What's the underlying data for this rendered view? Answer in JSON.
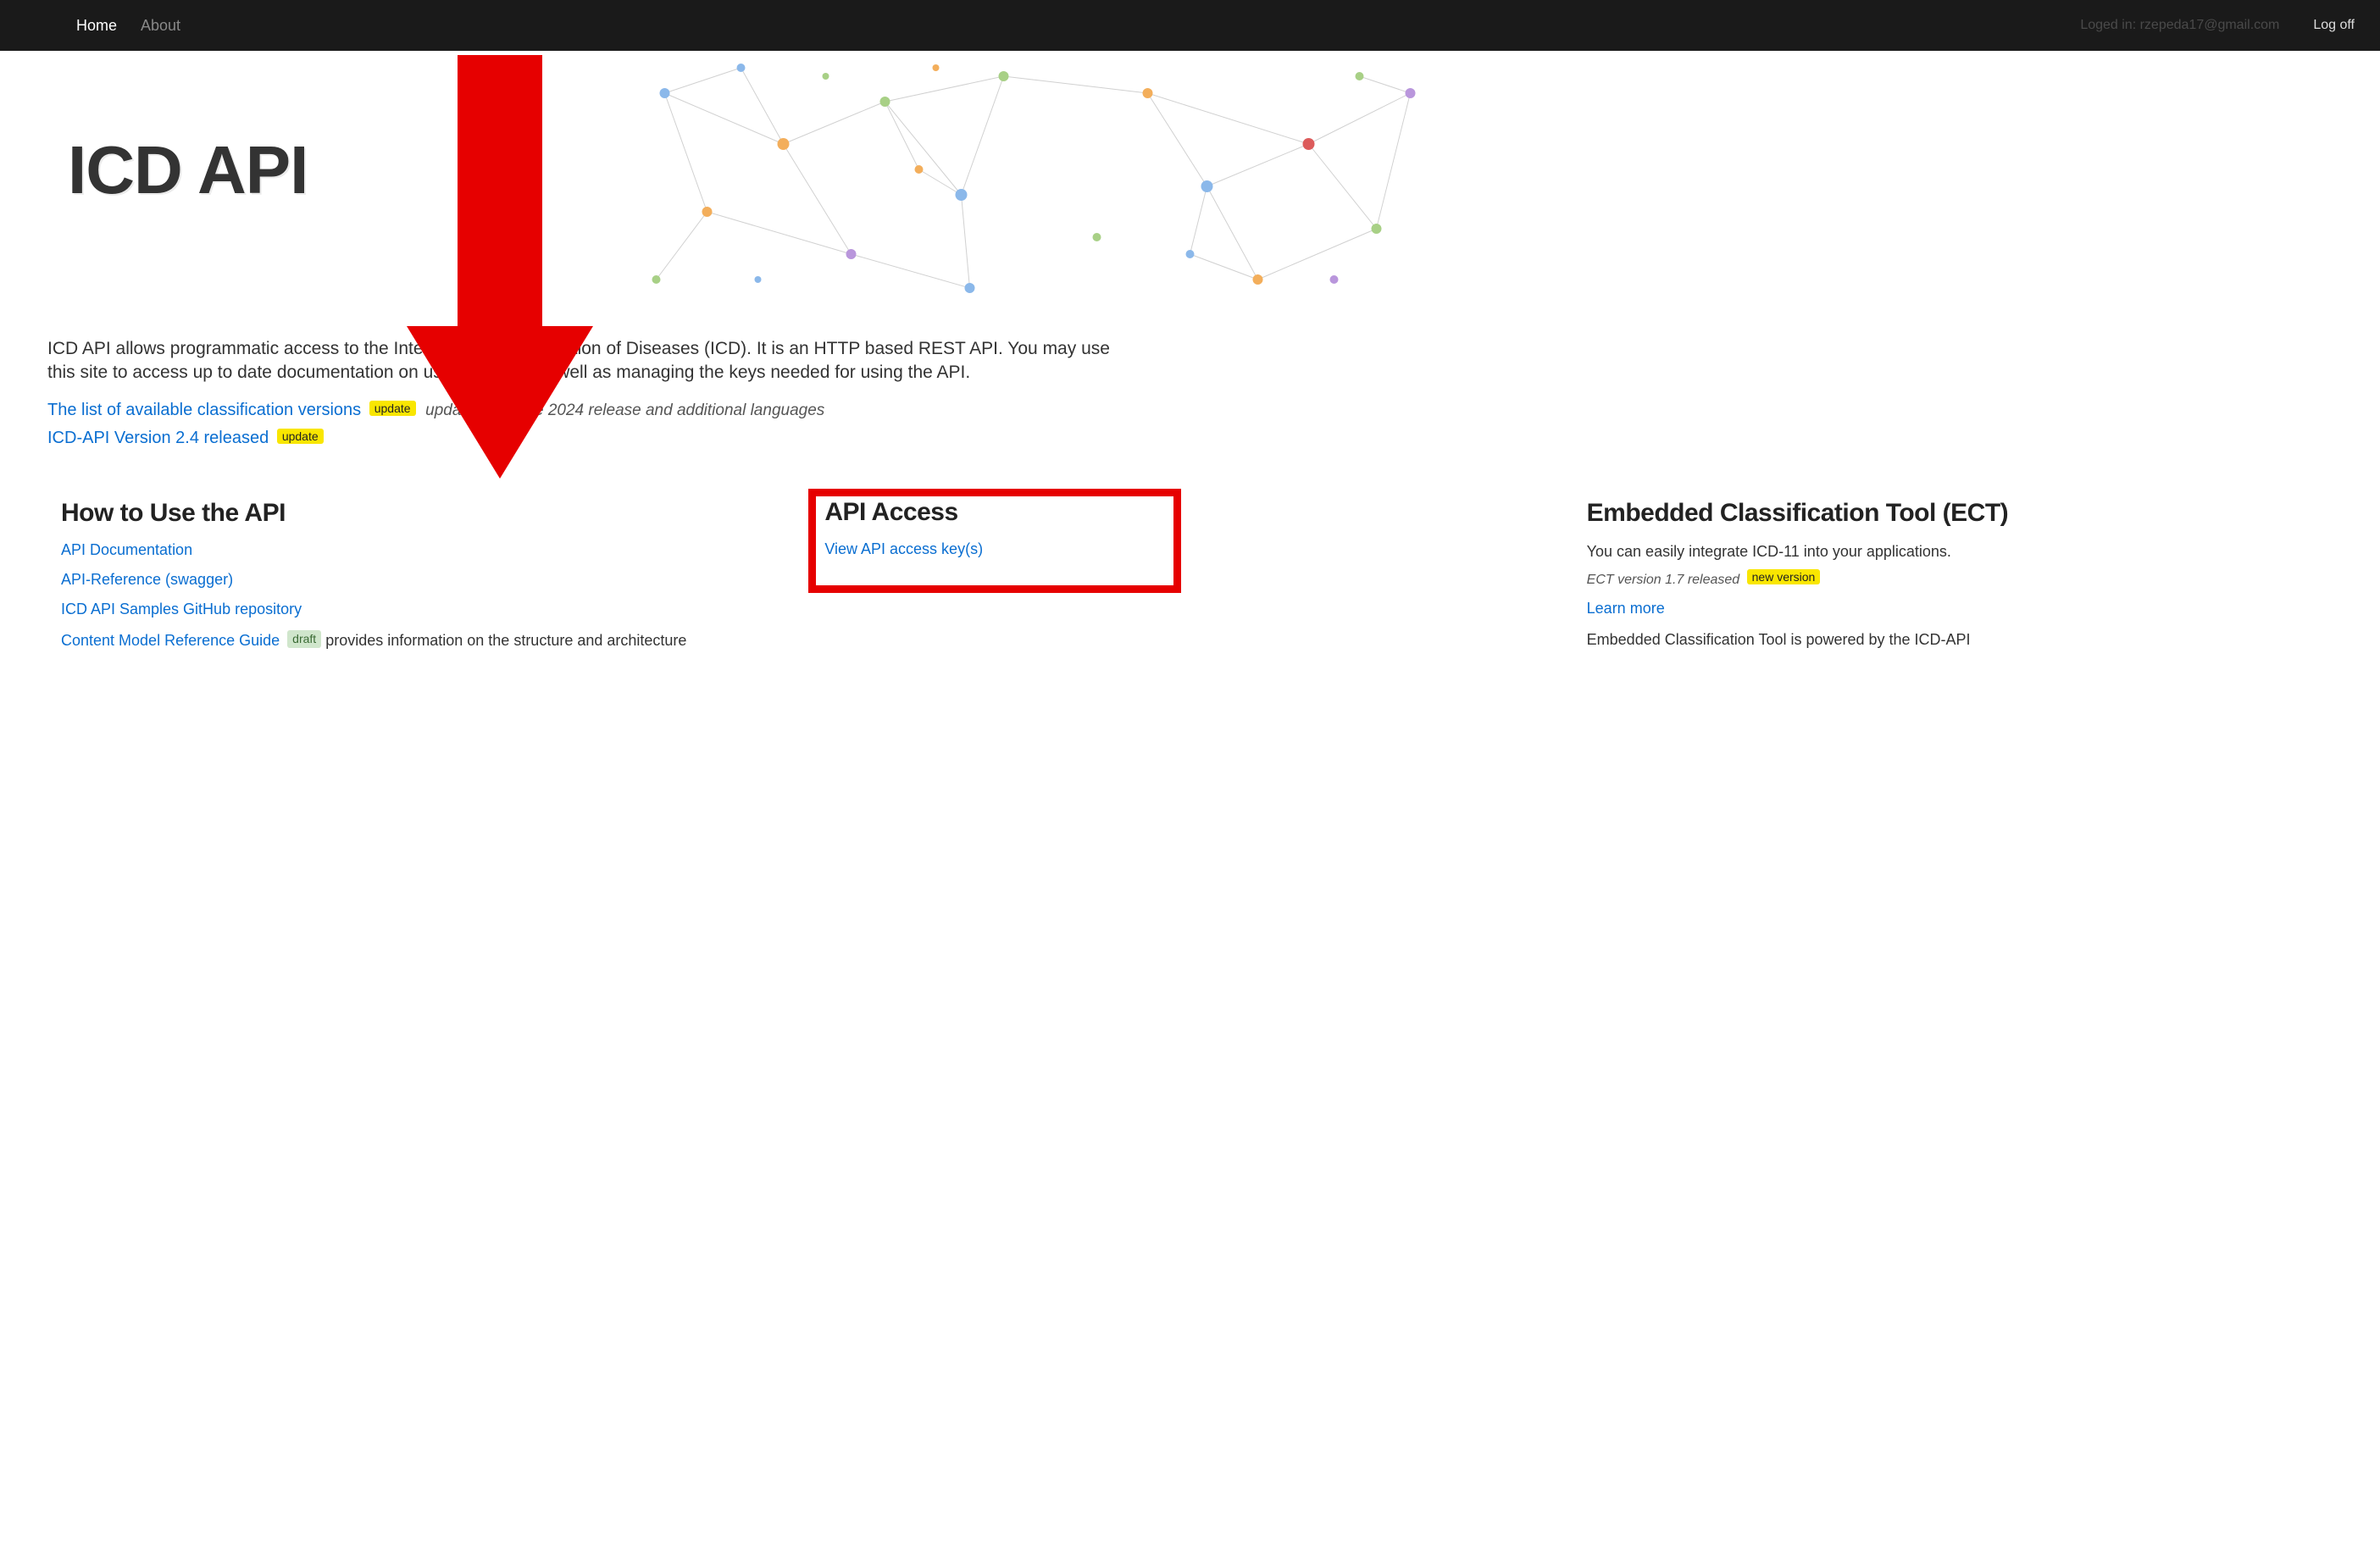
{
  "nav": {
    "home": "Home",
    "about": "About",
    "login_label": "Loged in: rzepeda17@gmail.com",
    "logoff": "Log off"
  },
  "hero": {
    "title": "ICD API"
  },
  "intro": {
    "text": "ICD API allows programmatic access to the International Classification of Diseases (ICD). It is an HTTP based REST API. You may use this site to access up to date documentation on using the API as well as managing the keys needed for using the API."
  },
  "updates": {
    "row1_link": "The list of available classification versions",
    "row1_badge": "update",
    "row1_note": "updated with the 2024 release and additional languages",
    "row2_link": "ICD-API Version 2.4 released",
    "row2_badge": "update"
  },
  "col1": {
    "heading": "How to Use the API",
    "link1": "API Documentation",
    "link2": "API-Reference (swagger)",
    "link3": "ICD API Samples GitHub repository",
    "link4": "Content Model Reference Guide",
    "link4_badge": "draft",
    "link4_suffix": " provides information on the structure and architecture"
  },
  "col2": {
    "heading": "API Access",
    "link1": "View API access key(s)"
  },
  "col3": {
    "heading": "Embedded Classification Tool (ECT)",
    "desc": "You can easily integrate ICD-11 into your applications.",
    "note": "ECT version 1.7 released",
    "note_badge": "new version",
    "learn": "Learn more",
    "footer": "Embedded Classification Tool is powered by the ICD-API"
  }
}
